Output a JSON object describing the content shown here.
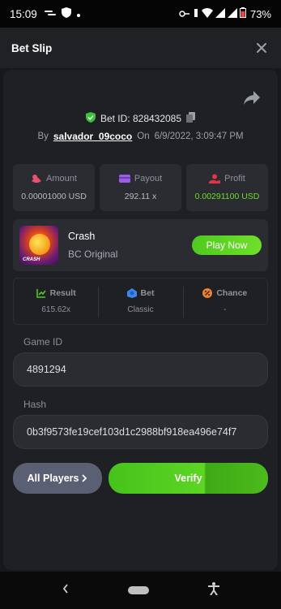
{
  "status_bar": {
    "time": "15:09",
    "battery_pct": "73%"
  },
  "header": {
    "title": "Bet Slip"
  },
  "bet": {
    "id_label": "Bet ID: 828432085",
    "by_label": "By",
    "username": "salvador_09coco",
    "on_label": "On",
    "datetime": "6/9/2022, 3:09:47 PM"
  },
  "stats": [
    {
      "label": "Amount",
      "value": "0.00001000 USD",
      "icon": "coins-icon",
      "color": "#e8506c"
    },
    {
      "label": "Payout",
      "value": "292.11 x",
      "icon": "wallet-icon",
      "color": "#9b5de5"
    },
    {
      "label": "Profit",
      "value": "0.00291100 USD",
      "icon": "hand-coins-icon",
      "color": "#e0344a"
    }
  ],
  "game": {
    "name": "Crash",
    "provider": "BC Original",
    "play_label": "Play Now",
    "thumb_text": "CRASH"
  },
  "results": [
    {
      "label": "Result",
      "value": "615.62x",
      "icon": "chart-up-icon"
    },
    {
      "label": "Bet",
      "value": "Classic",
      "icon": "chip-icon"
    },
    {
      "label": "Chance",
      "value": "-",
      "icon": "percent-icon"
    }
  ],
  "fields": {
    "game_id_label": "Game ID",
    "game_id_value": "4891294",
    "hash_label": "Hash",
    "hash_value": "0b3f9573fe19cef103d1c2988bf918ea496e74f7"
  },
  "actions": {
    "all_players": "All Players",
    "verify": "Verify"
  },
  "colors": {
    "accent_green": "#5cd523",
    "profit_green": "#6ddc2c",
    "card_bg": "#1f2024"
  }
}
